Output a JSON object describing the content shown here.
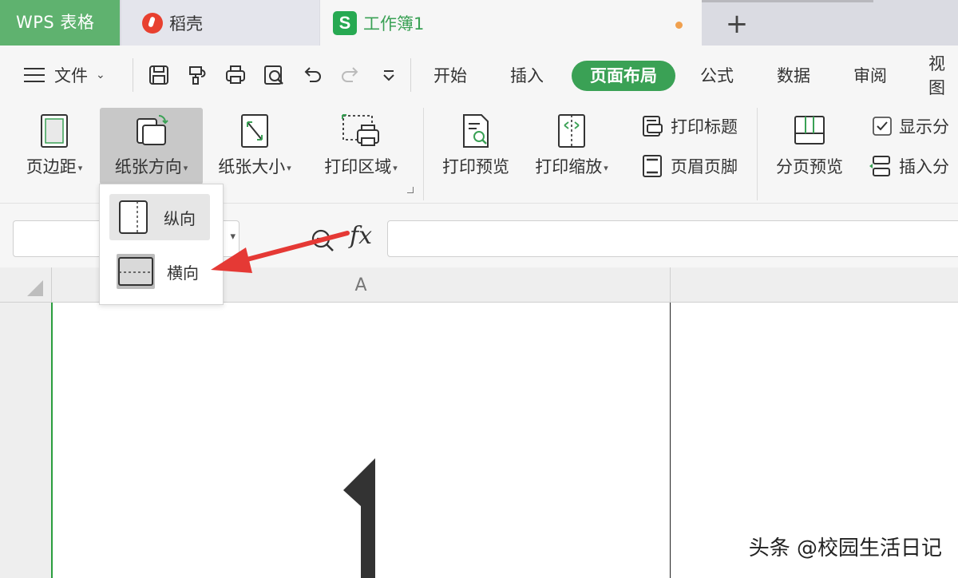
{
  "tabs": {
    "app_label": "WPS 表格",
    "daoke_label": "稻壳",
    "document_label": "工作簿1",
    "document_logo_letter": "S",
    "new_tab_symbol": "+"
  },
  "menu": {
    "file_label": "文件",
    "tabs": [
      "开始",
      "插入",
      "页面布局",
      "公式",
      "数据",
      "审阅",
      "视图"
    ],
    "active_tab": "页面布局",
    "quick_access_icons": [
      "save-icon",
      "format-painter-icon",
      "print-icon",
      "print-preview-icon",
      "undo-icon",
      "redo-icon",
      "customize-icon"
    ]
  },
  "ribbon": {
    "margins_label": "页边距",
    "orientation_label": "纸张方向",
    "size_label": "纸张大小",
    "print_area_label": "打印区域",
    "print_preview_label": "打印预览",
    "print_scale_label": "打印缩放",
    "print_titles_label": "打印标题",
    "header_footer_label": "页眉页脚",
    "page_break_preview_label": "分页预览",
    "show_page_break_label": "显示分",
    "insert_page_break_label": "插入分"
  },
  "orientation_menu": {
    "portrait_label": "纵向",
    "landscape_label": "横向",
    "highlighted": "纵向"
  },
  "formula_bar": {
    "fx_label": "fx",
    "name_box_value": "",
    "formula_value": ""
  },
  "sheet": {
    "column_header": "A"
  },
  "watermark": "头条 @校园生活日记",
  "colors": {
    "accent_green": "#3aa155",
    "app_tab_green": "#5fb26f",
    "annotation_red": "#e53935"
  }
}
